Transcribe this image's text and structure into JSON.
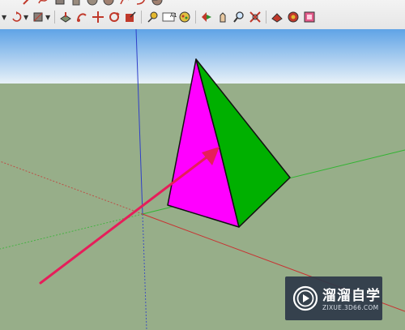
{
  "toolbar": {
    "row1_icons": [
      "pencil-icon",
      "freehand-icon",
      "rectangle-icon",
      "polygon-icon",
      "circle-icon",
      "sphere-icon",
      "arc-icon",
      "curve-icon",
      "pie-icon"
    ],
    "row2_icons": [
      "select-tool-icon",
      "rotate-tool-icon",
      "paint-tool-icon",
      "push-pull-icon",
      "follow-me-icon",
      "move-icon",
      "offset-icon",
      "scale-icon",
      "tape-measure-icon",
      "text-tool-icon",
      "paint-bucket-icon",
      "orbit-icon",
      "pan-icon",
      "zoom-icon",
      "zoom-extents-icon",
      "3d-warehouse-icon",
      "components-icon",
      "extension-icon"
    ],
    "text_tool_glyph": "A1"
  },
  "scene": {
    "sky_color_top": "#5fa3e6",
    "sky_color_bottom": "#e8f1f8",
    "ground_color": "#97ae89",
    "pyramid_left_face_color": "#ff00ff",
    "pyramid_right_face_color": "#00b000",
    "axis_red_color": "#c83232",
    "axis_green_color": "#32b432",
    "axis_blue_color": "#2f3fc8",
    "arrow_color": "#e61e5a"
  },
  "watermark": {
    "title": "溜溜自学",
    "url": "ZIXUE.3D66.COM"
  }
}
